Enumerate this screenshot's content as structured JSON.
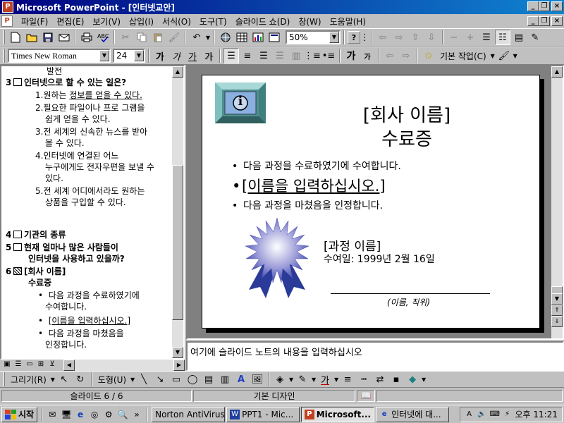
{
  "window": {
    "title": "Microsoft PowerPoint - [인터넷교안]",
    "min": "_",
    "restore": "❐",
    "close": "×",
    "app_icon": "P"
  },
  "menubar": {
    "items": [
      "파일(F)",
      "편집(E)",
      "보기(V)",
      "삽입(I)",
      "서식(O)",
      "도구(T)",
      "슬라이드 쇼(D)",
      "창(W)",
      "도움말(H)"
    ]
  },
  "toolbar_standard": {
    "zoom": "50%",
    "help": "?"
  },
  "toolbar_format": {
    "font": "Times New Roman",
    "size": "24",
    "bold": "가",
    "italic": "가",
    "underline": "가",
    "shadow": "가",
    "common_tasks": "기본 작업(C)",
    "grow_font": "가",
    "shrink_font": "가"
  },
  "outline": {
    "lines": [
      {
        "indent": 64,
        "text": "발전"
      },
      {
        "num": "3",
        "box": true,
        "text": "인터넷으로 할 수 있는 일은?",
        "bold": true
      },
      {
        "indent": 48,
        "text": "1.원하는 ",
        "u": "정보를 얻을 수 있다."
      },
      {
        "indent": 48,
        "text": "2.필요한 파일이나 프로 그램을"
      },
      {
        "indent": 62,
        "text": "쉽게 얻을 수 있다."
      },
      {
        "indent": 48,
        "text": "3.전 세계의 신속한 뉴스를 받아"
      },
      {
        "indent": 62,
        "text": "볼 수 있다."
      },
      {
        "indent": 48,
        "text": "4.인터넷에 연결된 어느"
      },
      {
        "indent": 62,
        "text": "누구에게도 전자우편을 보낼 수"
      },
      {
        "indent": 62,
        "text": "있다."
      },
      {
        "indent": 48,
        "text": "5.전 세계 어디에서라도 원하는"
      },
      {
        "indent": 62,
        "text": "상품을 구입할 수 있다."
      },
      {
        "num": "4",
        "box": true,
        "text": "기관의 종류",
        "bold": true
      },
      {
        "num": "5",
        "box": true,
        "text": "현재 얼마나 많은 사람들이",
        "bold": true
      },
      {
        "indent": 38,
        "text": "인터넷을 사용하고 있을까?",
        "bold": true
      },
      {
        "num": "6",
        "box": true,
        "graphic": true,
        "text": "[회사 이름]",
        "bold": true
      },
      {
        "indent": 38,
        "text": "수료증",
        "bold": true
      },
      {
        "indent": 52,
        "text": "•  다음 과정을 수료하였기에"
      },
      {
        "indent": 62,
        "text": "수여합니다."
      },
      {
        "indent": 52,
        "text": "•  ",
        "u": "[이름을 입력하십시오.]"
      },
      {
        "indent": 52,
        "text": "•  다음 과정을 마쳤음을"
      },
      {
        "indent": 62,
        "text": "인정합니다."
      }
    ]
  },
  "slide": {
    "title_line1": "[회사 이름]",
    "title_line2": "수료증",
    "bullet1": "다음 과정을 수료하였기에 수여합니다.",
    "bullet2": "[이름을 입력하십시오.]",
    "bullet3": "다음 과정을 마쳤음을 인정합니다.",
    "bullet_char": "•",
    "course_name": "[과정 이름]",
    "award_date": "수여일: 1999년 2월 16일",
    "signature_label": "(이름, 직위)",
    "info_glyph": "i"
  },
  "notes": {
    "placeholder": "여기에 슬라이드 노트의 내용을 입력하십시오"
  },
  "drawing_toolbar": {
    "draw_menu": "그리기(R)",
    "autoshapes_menu": "도형(U)",
    "font_color": "가"
  },
  "statusbar": {
    "slide": "슬라이드 6 / 6",
    "design": "기본 디자인"
  },
  "taskbar": {
    "start": "시작",
    "tasks": [
      {
        "label": "Norton AntiVirus",
        "active": false
      },
      {
        "label": "PPT1 - Mic...",
        "active": false
      },
      {
        "label": "Microsoft...",
        "active": true
      },
      {
        "label": "인터넷에 대...",
        "active": false
      }
    ],
    "chevron": "»",
    "clock": "오후 11:21"
  },
  "colors": {
    "titlebar_start": "#000080",
    "titlebar_end": "#1084d0",
    "chrome": "#c0c0c0",
    "slide_bg": "#ffffff",
    "ribbon_blue": "#3a4aa8"
  }
}
